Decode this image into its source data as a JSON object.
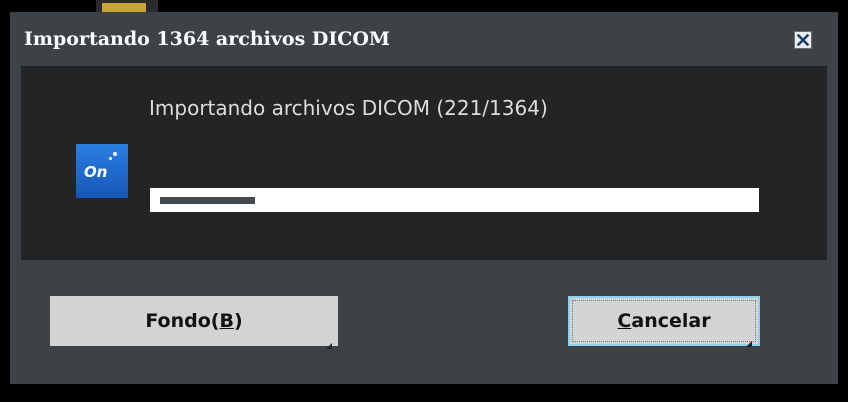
{
  "dialog": {
    "title": "Importando 1364 archivos DICOM",
    "close_icon": "close-x-icon"
  },
  "content": {
    "message": "Importando archivos DICOM (221/1364)",
    "app_logo": {
      "text": "On",
      "icon": "app-logo-icon",
      "color": "#1f6fd6"
    },
    "progress": {
      "current": 221,
      "total": 1364,
      "fraction": 0.162
    }
  },
  "buttons": {
    "background": {
      "label_prefix": "Fondo(",
      "label_mnemonic": "B",
      "label_suffix": ")"
    },
    "cancel": {
      "label_mnemonic": "C",
      "label_rest": "ancelar",
      "focus_color": "#8fd0ec"
    }
  }
}
